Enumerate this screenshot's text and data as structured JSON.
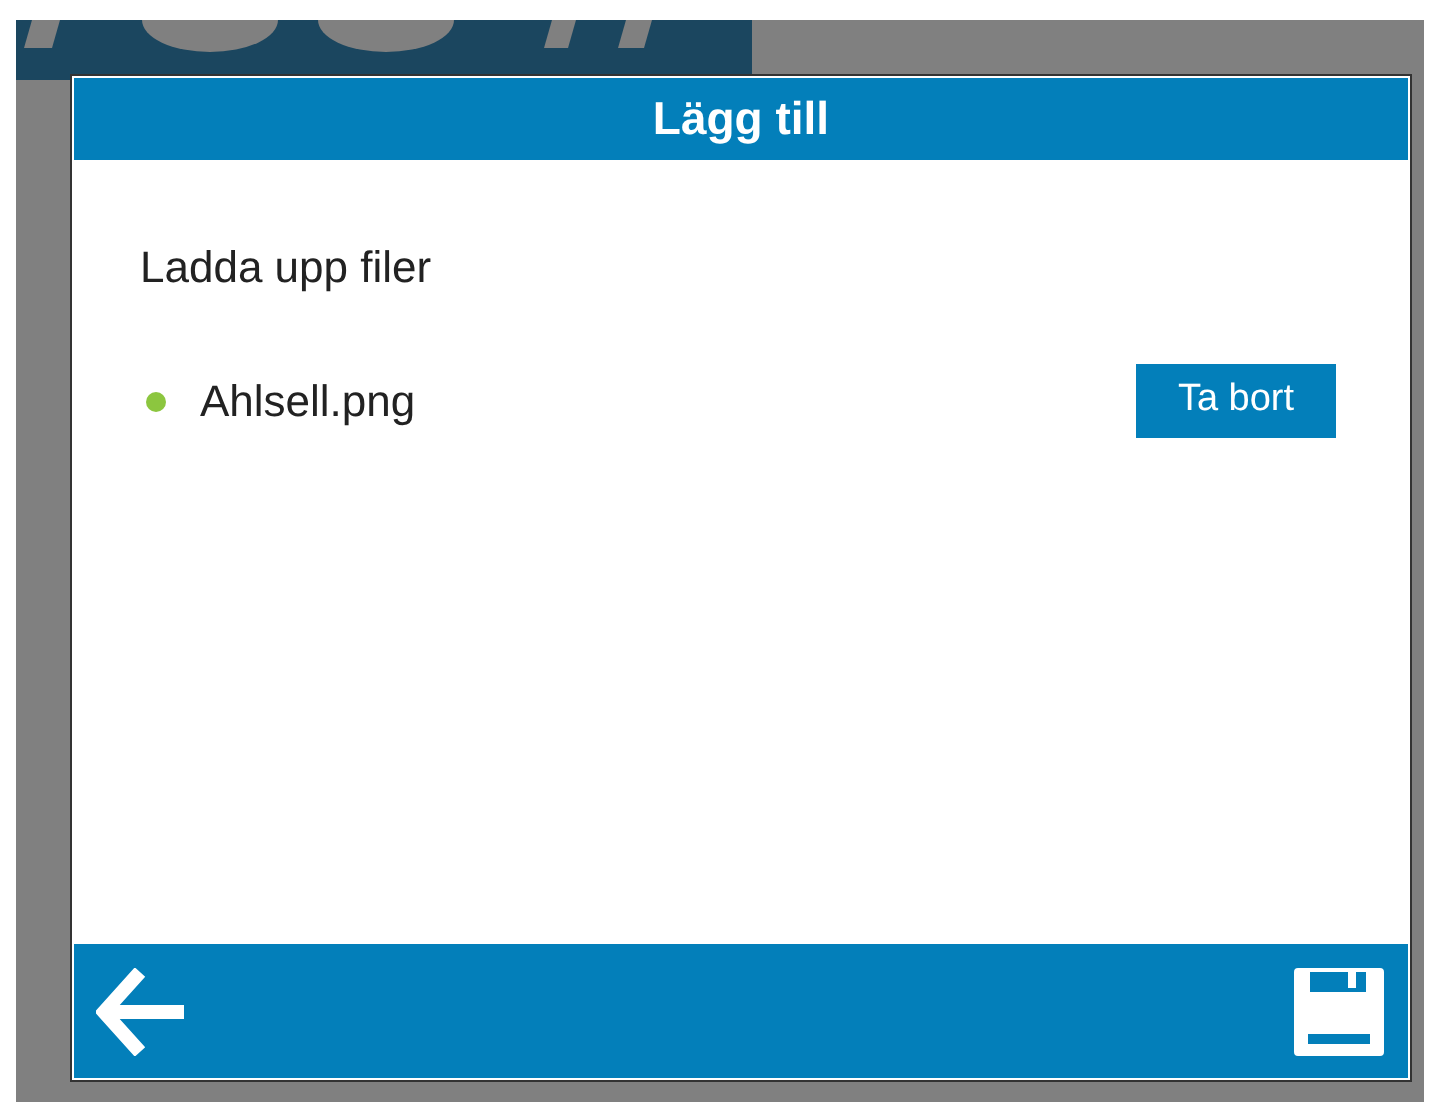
{
  "dialog": {
    "title": "Lägg till",
    "section_label": "Ladda upp filer",
    "files": [
      {
        "name": "Ahlsell.png",
        "color": "#8cc63f",
        "remove_label": "Ta bort"
      }
    ]
  }
}
